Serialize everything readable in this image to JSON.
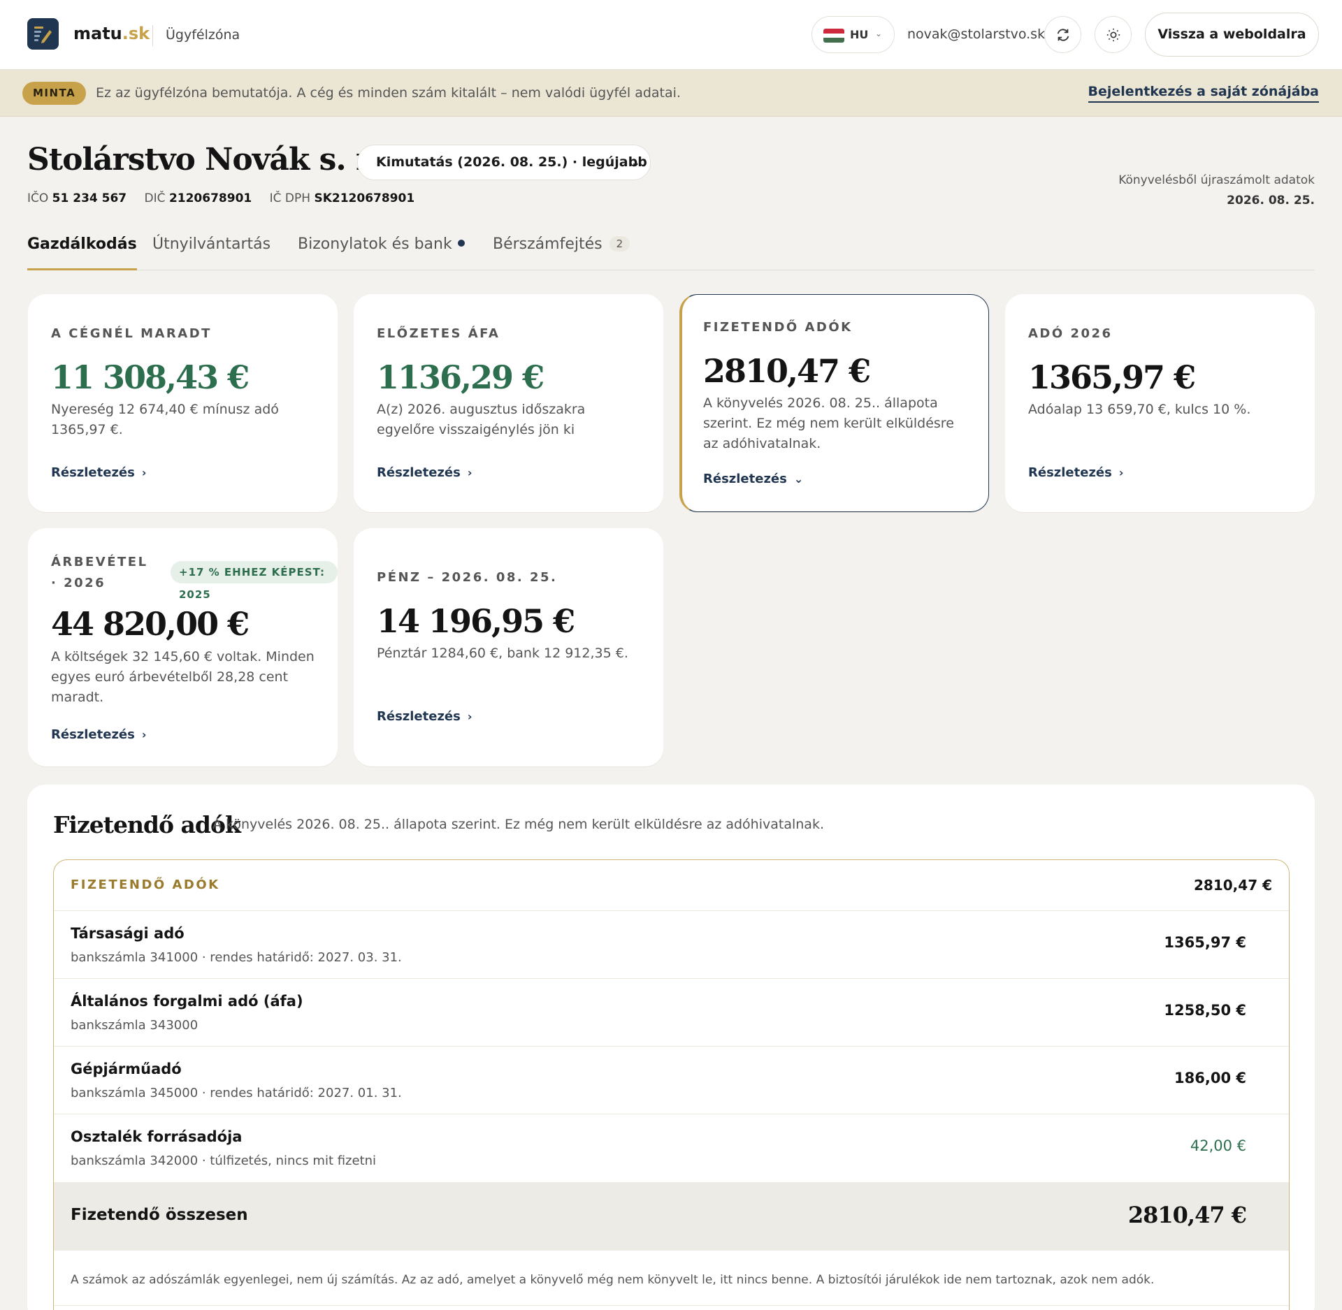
{
  "header": {
    "brand_name": "matu",
    "brand_tld": ".sk",
    "zone_label": "Ügyfélzóna",
    "lang_code": "HU",
    "email": "novak@stolarstvo.sk",
    "back_label": "Vissza a weboldalra",
    "flag_colors": [
      "#cd2a3e",
      "#ffffff",
      "#436f4d"
    ]
  },
  "banner": {
    "badge": "MINTA",
    "text": "Ez az ügyfélzóna bemutatója. A cég és minden szám kitalált – nem valódi ügyfél adatai.",
    "link": "Bejelentkezés a saját zónájába"
  },
  "company": {
    "name": "Stolárstvo Novák s. r. o.",
    "report_select": "Kimutatás (2026. 08. 25.) · legújabb",
    "ico_label": "IČO",
    "ico": "51 234 567",
    "dic_label": "DIČ",
    "dic": "2120678901",
    "icdph_label": "IČ DPH",
    "icdph": "SK2120678901",
    "recalc_text": "Könyvelésből újraszámolt adatok",
    "recalc_date": "2026. 08. 25."
  },
  "tabs": [
    {
      "label": "Gazdálkodás",
      "active": true
    },
    {
      "label": "Útnyilvántartás"
    },
    {
      "label": "Bizonylatok és bank",
      "dot": true
    },
    {
      "label": "Bérszámfejtés",
      "count": "2"
    }
  ],
  "cards": {
    "retained": {
      "label": "A CÉGNÉL MARADT",
      "value": "11 308,43 €",
      "desc": "Nyereség 12 674,40 € mínusz adó 1365,97 €.",
      "link": "Részletezés"
    },
    "vat": {
      "label": "ELŐZETES ÁFA",
      "value": "1136,29 €",
      "desc": "A(z) 2026. augusztus időszakra egyelőre visszaigénylés jön ki",
      "link": "Részletezés"
    },
    "taxes": {
      "label": "FIZETENDŐ ADÓK",
      "value": "2810,47 €",
      "desc": "A könyvelés 2026. 08. 25.. állapota szerint. Ez még nem került elküldésre az adóhivatalnak.",
      "link": "Részletezés"
    },
    "tax2026": {
      "label": "ADÓ 2026",
      "value": "1365,97 €",
      "desc": "Adóalap 13 659,70 €, kulcs 10 %.",
      "link": "Részletezés"
    },
    "revenue": {
      "label_line1": "ÁRBEVÉTEL",
      "label_line2": "· 2026",
      "badge": "+17 % EHHEZ KÉPEST: 2025",
      "value": "44 820,00 €",
      "desc": "A költségek 32 145,60 € voltak. Minden egyes euró árbevételből 28,28 cent maradt.",
      "link": "Részletezés"
    },
    "cash": {
      "label": "PÉNZ – 2026. 08. 25.",
      "value": "14 196,95 €",
      "desc": "Pénztár 1284,60 €, bank 12 912,35 €.",
      "link": "Részletezés"
    }
  },
  "taxes_panel": {
    "title": "Fizetendő adók",
    "subtitle": "A könyvelés 2026. 08. 25.. állapota szerint. Ez még nem került elküldésre az adóhivatalnak.",
    "box_label": "FIZETENDŐ ADÓK",
    "box_total": "2810,47 €",
    "rows": [
      {
        "name": "Társasági adó",
        "meta": "bankszámla 341000 · rendes határidő: 2027. 03. 31.",
        "amount": "1365,97 €"
      },
      {
        "name": "Általános forgalmi adó (áfa)",
        "meta": "bankszámla 343000",
        "amount": "1258,50 €"
      },
      {
        "name": "Gépjárműadó",
        "meta": "bankszámla 345000 · rendes határidő: 2027. 01. 31.",
        "amount": "186,00 €"
      },
      {
        "name": "Osztalék forrásadója",
        "meta": "bankszámla 342000 · túlfizetés, nincs mit fizetni",
        "amount": "42,00 €"
      }
    ],
    "total_label": "Fizetendő összesen",
    "total_value": "2810,47 €",
    "note": "A számok az adószámlák egyenlegei, nem új számítás. Az az adó, amelyet a könyvelő még nem könyvelt le, itt nincs benne. A biztosítói járulékok ide nem tartoznak, azok nem adók."
  },
  "colors": {
    "accent": "#c8a24a",
    "navy": "#1f3550",
    "green": "#2c6e4d"
  }
}
